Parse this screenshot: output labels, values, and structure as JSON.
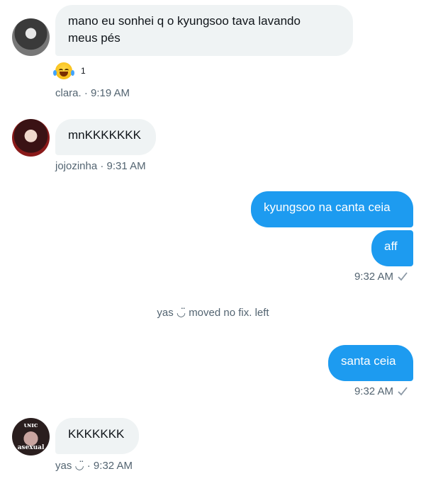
{
  "messages": [
    {
      "text": "mano eu sonhei q o kyungsoo tava lavando meus pés",
      "meta": "clara. · 9:19 AM",
      "reaction": {
        "icon": "face-with-tears-of-joy-icon",
        "count": "1"
      }
    },
    {
      "text": "mnKKKKKKK",
      "meta": "jojozinha · 9:31 AM"
    },
    {
      "text": "kyungsoo na canta ceia"
    },
    {
      "text": "aff",
      "meta": "9:32 AM"
    },
    {
      "text": "santa ceia",
      "meta": "9:32 AM"
    },
    {
      "text": "KKKKKKK",
      "meta": "yas ◡̈ · 9:32 AM"
    }
  ],
  "event": "yas ◡̈ moved no fix. left",
  "avatars": {
    "third": {
      "top": "ιɴɪc",
      "bottom": "asexual"
    }
  },
  "colors": {
    "outgoing": "#1d9bf0",
    "incoming": "#eff3f4",
    "meta": "#536471"
  }
}
